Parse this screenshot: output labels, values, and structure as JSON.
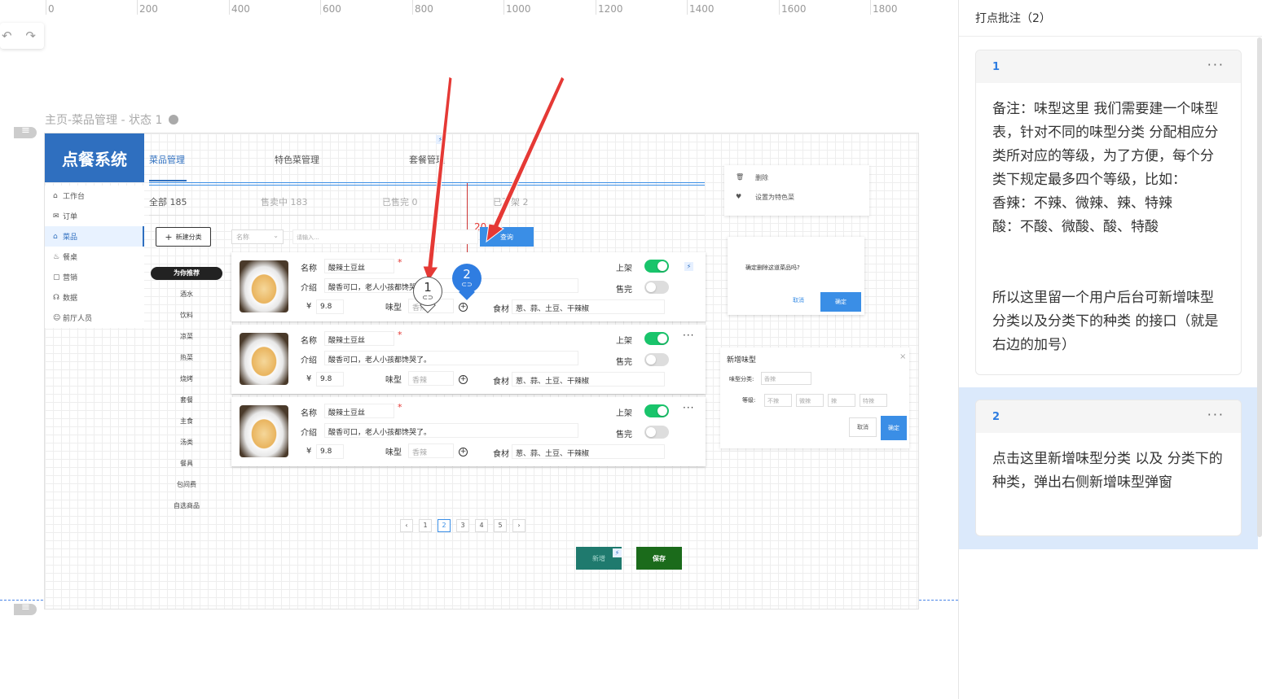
{
  "ruler": {
    "labels": [
      "0",
      "200",
      "400",
      "600",
      "800",
      "1000",
      "1200",
      "1400",
      "1600",
      "1800"
    ]
  },
  "canvas": {
    "page_title": "主页-菜品管理 - 状态 1"
  },
  "prototype": {
    "logo": "点餐系统",
    "nav": [
      {
        "icon": "⌂",
        "label": "工作台"
      },
      {
        "icon": "✉",
        "label": "订单"
      },
      {
        "icon": "⌂",
        "label": "菜品"
      },
      {
        "icon": "♨",
        "label": "餐桌"
      },
      {
        "icon": "▢",
        "label": "营销"
      },
      {
        "icon": "☊",
        "label": "数据"
      },
      {
        "icon": "☺",
        "label": "前厅人员"
      }
    ],
    "tabs": [
      "菜品管理",
      "特色菜管理",
      "套餐管理"
    ],
    "status": [
      "全部 185",
      "售卖中 183",
      "已售完 0",
      "已下架 2"
    ],
    "new_category": "新建分类",
    "name_select": "名称",
    "search_placeholder": "请输入...",
    "query": "查询",
    "red_number": "20",
    "categories": [
      "为你推荐",
      "酒水",
      "饮料",
      "凉菜",
      "热菜",
      "烧烤",
      "套餐",
      "主食",
      "汤类",
      "餐具",
      "包间费",
      "自选商品"
    ],
    "dish": {
      "name_label": "名称",
      "name_value": "酸辣土豆丝",
      "intro_label": "介绍",
      "intro_value": "酸香可口，老人小孩都馋哭了。",
      "price_symbol": "¥",
      "price_value": "9.8",
      "flavor_label": "味型",
      "flavor_value": "香辣",
      "ingredient_label": "食材",
      "ingredient_value": "葱、蒜、土豆、干辣椒",
      "on_shelf": "上架",
      "sold_out": "售完"
    },
    "pager": [
      "‹",
      "1",
      "2",
      "3",
      "4",
      "5",
      "›"
    ],
    "add_btn": "新增",
    "save_btn": "保存",
    "ctx_menu": [
      "删除",
      "设置为特色菜"
    ],
    "confirm": {
      "text": "确定删除这道菜品吗?",
      "cancel": "取消",
      "ok": "确定"
    },
    "flavor_dialog": {
      "title": "新增味型",
      "type_label": "味型分类:",
      "type_value": "香辣",
      "level_label": "等级:",
      "levels": [
        "不辣",
        "微辣",
        "辣",
        "特辣"
      ],
      "cancel": "取消",
      "ok": "确定"
    }
  },
  "pins": [
    {
      "num": "1"
    },
    {
      "num": "2"
    }
  ],
  "colors": {
    "accent": "#2f7de1",
    "logo": "#2f6fbf",
    "toggle_on": "#19c46b",
    "arrow": "#e53935"
  },
  "panel": {
    "title": "打点批注（2）",
    "comments": [
      {
        "num": "1",
        "more": "···",
        "text": "备注：味型这里 我们需要建一个味型表，针对不同的味型分类 分配相应分类所对应的等级，为了方便，每个分类下规定最多四个等级，比如：\n香辣：不辣、微辣、辣、特辣\n酸：不酸、微酸、酸、特酸\n\n\n所以这里留一个用户后台可新增味型分类以及分类下的种类 的接口（就是右边的加号）"
      },
      {
        "num": "2",
        "more": "···",
        "text": "点击这里新增味型分类 以及 分类下的种类，弹出右侧新增味型弹窗"
      }
    ]
  }
}
